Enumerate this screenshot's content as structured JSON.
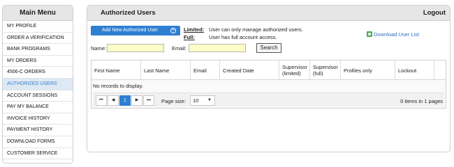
{
  "sidebar": {
    "title": "Main Menu",
    "items": [
      {
        "label": "MY PROFILE",
        "active": false
      },
      {
        "label": "ORDER A VERIFICATION",
        "active": false
      },
      {
        "label": "BANK PROGRAMS",
        "active": false
      },
      {
        "label": "MY ORDERS",
        "active": false
      },
      {
        "label": "4506-C ORDERS",
        "active": false
      },
      {
        "label": "AUTHORIZED USERS",
        "active": true
      },
      {
        "label": "ACCOUNT SESSIONS",
        "active": false
      },
      {
        "label": "PAY MY BALANCE",
        "active": false
      },
      {
        "label": "INVOICE HISTORY",
        "active": false
      },
      {
        "label": "PAYMENT HISTORY",
        "active": false
      },
      {
        "label": "DOWNLOAD FORMS",
        "active": false
      },
      {
        "label": "CUSTOMER SERVICE",
        "active": false
      }
    ]
  },
  "panel": {
    "title": "Authorized Users",
    "logout_label": "Logout",
    "add_button_label": "Add New Authorized User",
    "legend": {
      "limited_key": "Limited",
      "limited_text": "User can only manage authorized users.",
      "full_key": "Full",
      "full_text": "User has full account access."
    },
    "download_label": "Download User List",
    "search": {
      "name_label": "Name:",
      "name_value": "",
      "email_label": "Email:",
      "email_value": "",
      "button_label": "Search"
    },
    "grid": {
      "columns": [
        "First Name",
        "Last Name",
        "Email",
        "Created Date",
        "Supervisor (limited)",
        "Supervisor (full)",
        "Profiles only",
        "Lockout"
      ],
      "empty_text": "No records to display.",
      "pager": {
        "first": "⏮",
        "prev": "◀",
        "current_page": "1",
        "next": "▶",
        "last": "⏭",
        "page_size_label": "Page size:",
        "page_size_value": "10",
        "info": "0 items in 1 pages"
      }
    }
  },
  "colors": {
    "accent": "#2e7fd1",
    "active_menu_text": "#3b7fc4",
    "input_bg": "#fdfbc6"
  },
  "icons": {
    "add": "plus-circle-icon",
    "download": "download-icon",
    "page_size": "chevron-down-icon"
  }
}
